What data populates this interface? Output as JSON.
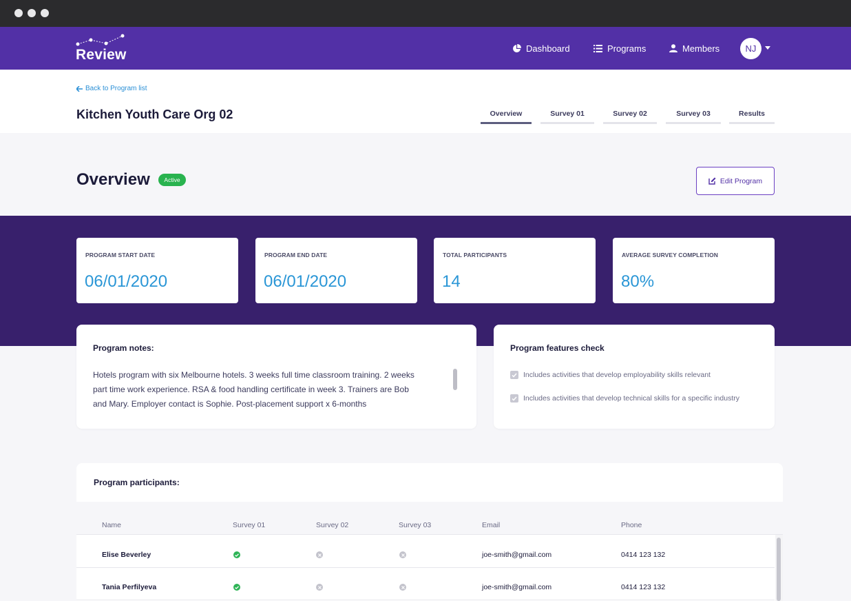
{
  "nav": {
    "logo": "Review",
    "items": [
      {
        "label": "Dashboard",
        "icon": "pie-chart-icon"
      },
      {
        "label": "Programs",
        "icon": "list-icon"
      },
      {
        "label": "Members",
        "icon": "user-icon"
      }
    ],
    "avatar_initials": "NJ"
  },
  "header": {
    "back_label": "Back to Program list",
    "title": "Kitchen Youth Care Org 02",
    "tabs": [
      {
        "label": "Overview",
        "active": true
      },
      {
        "label": "Survey 01",
        "active": false
      },
      {
        "label": "Survey 02",
        "active": false
      },
      {
        "label": "Survey 03",
        "active": false
      },
      {
        "label": "Results",
        "active": false
      }
    ]
  },
  "overview": {
    "heading": "Overview",
    "status_badge": "Active",
    "edit_button": "Edit Program"
  },
  "stats": [
    {
      "label": "PROGRAM START DATE",
      "value": "06/01/2020"
    },
    {
      "label": "PROGRAM END DATE",
      "value": "06/01/2020"
    },
    {
      "label": "TOTAL PARTICIPANTS",
      "value": "14"
    },
    {
      "label": "AVERAGE SURVEY COMPLETION",
      "value": "80%"
    }
  ],
  "notes": {
    "title": "Program notes:",
    "lines": [
      "Hotels program with six Melbourne hotels. 3 weeks full time classroom training. 2 weeks",
      "part time work experience. RSA & food handling certificate in week 3. Trainers are Bob",
      "and Mary. Employer contact is Sophie. Post-placement support x 6-months"
    ]
  },
  "features": {
    "title": "Program features check",
    "items": [
      {
        "label": "Includes activities that develop employability skills relevant",
        "checked": true
      },
      {
        "label": "Includes activities that develop technical skills for a specific industry",
        "checked": true
      }
    ]
  },
  "participants": {
    "title": "Program participants:",
    "columns": [
      "Name",
      "Survey 01",
      "Survey 02",
      "Survey 03",
      "Email",
      "Phone"
    ],
    "rows": [
      {
        "name": "Elise Beverley",
        "survey_01": "complete",
        "survey_02": "incomplete",
        "survey_03": "incomplete",
        "email": "joe-smith@gmail.com",
        "phone": "0414 123 132"
      },
      {
        "name": "Tania Perfilyeva",
        "survey_01": "complete",
        "survey_02": "incomplete",
        "survey_03": "incomplete",
        "email": "joe-smith@gmail.com",
        "phone": "0414 123 132"
      }
    ]
  },
  "colors": {
    "nav_purple": "#5230a6",
    "band_purple": "#38206c",
    "stat_blue": "#2a96d6",
    "badge_green": "#29b34f"
  }
}
